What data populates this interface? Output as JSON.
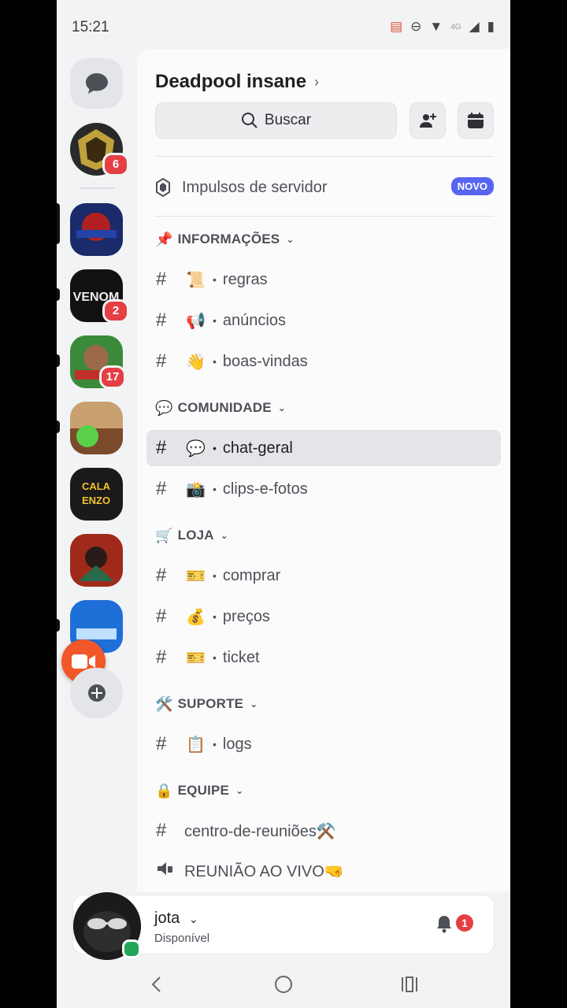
{
  "status_bar": {
    "time": "15:21",
    "network": "4G"
  },
  "server": {
    "name": "Deadpool insane",
    "search_label": "Buscar"
  },
  "boost": {
    "label": "Impulsos de servidor",
    "badge": "NOVO"
  },
  "rail": {
    "servers": [
      {
        "badge": "6",
        "color": "#c0a23a"
      },
      {
        "badge": "",
        "color": "#2244aa"
      },
      {
        "badge": "2",
        "color": "#222222"
      },
      {
        "badge": "17",
        "color": "#3a8a3a"
      },
      {
        "badge": "",
        "color": "#8a5a2a"
      },
      {
        "badge": "",
        "color": "#1a1a1a"
      },
      {
        "badge": "",
        "color": "#a02a1a"
      },
      {
        "badge": "",
        "color": "#1e6fd8"
      }
    ]
  },
  "categories": [
    {
      "emoji": "📌",
      "name": "INFORMAÇÕES"
    },
    {
      "emoji": "💬",
      "name": "COMUNIDADE"
    },
    {
      "emoji": "🛒",
      "name": "LOJA"
    },
    {
      "emoji": "🛠️",
      "name": "SUPORTE"
    },
    {
      "emoji": "🔒",
      "name": "EQUIPE"
    }
  ],
  "channels": [
    {
      "emoji": "📜",
      "name": "regras"
    },
    {
      "emoji": "📢",
      "name": "anúncios"
    },
    {
      "emoji": "👋",
      "name": "boas-vindas"
    },
    {
      "emoji": "💬",
      "name": "chat-geral"
    },
    {
      "emoji": "📸",
      "name": "clips-e-fotos"
    },
    {
      "emoji": "🎫",
      "name": "comprar"
    },
    {
      "emoji": "💰",
      "name": "preços"
    },
    {
      "emoji": "🎫",
      "name": "ticket"
    },
    {
      "emoji": "📋",
      "name": "logs"
    }
  ],
  "equipe_channels": [
    {
      "name": "centro-de-reuniões⚒️"
    },
    {
      "name": "REUNIÃO AO VIVO🤜"
    }
  ],
  "user": {
    "name": "jota",
    "status": "Disponível",
    "notifications": "1"
  }
}
